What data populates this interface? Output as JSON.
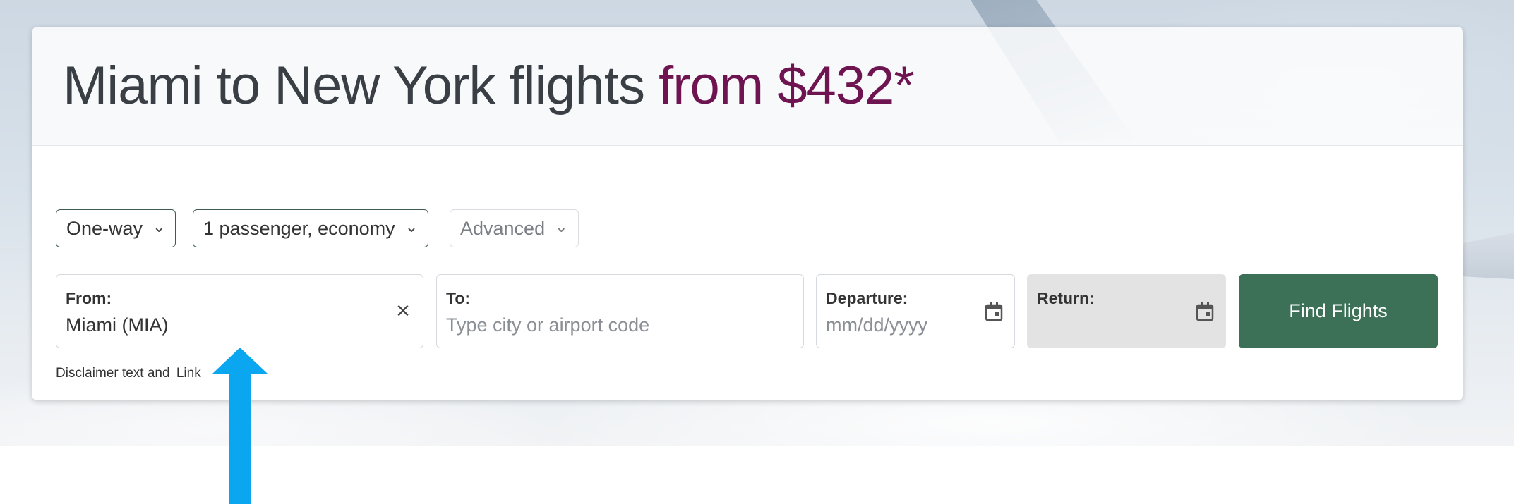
{
  "header": {
    "title_main": "Miami to New York flights",
    "title_price": "from $432*"
  },
  "options": {
    "trip_type": "One-way",
    "passengers": "1 passenger, economy",
    "advanced": "Advanced"
  },
  "search": {
    "from": {
      "label": "From:",
      "value": "Miami (MIA)"
    },
    "to": {
      "label": "To:",
      "placeholder": "Type city or airport code"
    },
    "departure": {
      "label": "Departure:",
      "placeholder": "mm/dd/yyyy"
    },
    "return": {
      "label": "Return:"
    },
    "submit_label": "Find Flights"
  },
  "disclaimer": {
    "text": "Disclaimer text and",
    "link": "Link"
  },
  "icons": {
    "dropdown": "chevron-down-icon",
    "clear": "close-icon",
    "calendar": "calendar-icon",
    "annotation": "arrow-up-icon"
  },
  "colors": {
    "title": "#3a3f45",
    "price": "#6e1450",
    "primary_button": "#3c7157",
    "annotation_arrow": "#0aa7f0"
  }
}
